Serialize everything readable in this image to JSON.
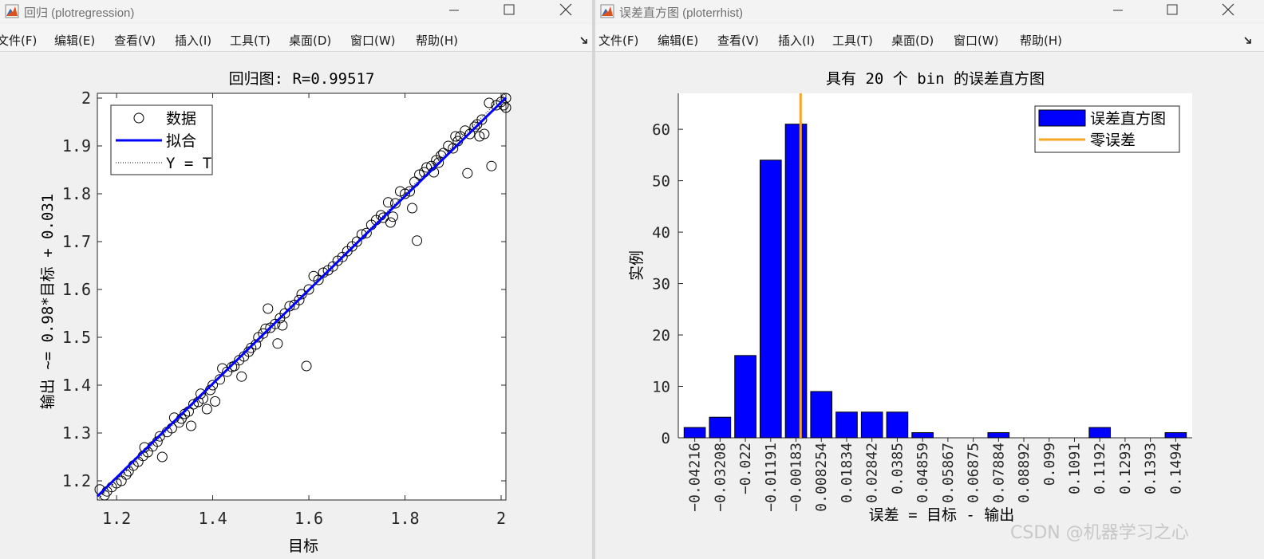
{
  "left_window": {
    "title": "回归 (plotregression)",
    "menu": [
      "文件(F)",
      "编辑(E)",
      "查看(V)",
      "插入(I)",
      "工具(T)",
      "桌面(D)",
      "窗口(W)",
      "帮助(H)"
    ],
    "icons": [
      "matlab-icon",
      "minimize-icon",
      "maximize-icon",
      "close-icon",
      "dock-arrow-icon"
    ]
  },
  "right_window": {
    "title": "误差直方图 (ploterrhist)",
    "menu": [
      "文件(F)",
      "编辑(E)",
      "查看(V)",
      "插入(I)",
      "工具(T)",
      "桌面(D)",
      "窗口(W)",
      "帮助(H)"
    ],
    "icons": [
      "matlab-icon",
      "minimize-icon",
      "maximize-icon",
      "close-icon",
      "dock-arrow-icon"
    ]
  },
  "watermark": "CSDN @机器学习之心",
  "chart_data": [
    {
      "type": "scatter",
      "title": "回归图: R=0.99517",
      "xlabel": "目标",
      "ylabel": "输出 ~= 0.98*目标 + 0.031",
      "xlim": [
        1.16,
        2.01
      ],
      "ylim": [
        1.16,
        2.01
      ],
      "xticks": [
        1.2,
        1.4,
        1.6,
        1.8,
        2
      ],
      "yticks": [
        1.2,
        1.3,
        1.4,
        1.5,
        1.6,
        1.7,
        1.8,
        1.9,
        2
      ],
      "tick_labels_x": [
        "1.2",
        "1.4",
        "1.6",
        "1.8",
        "2"
      ],
      "tick_labels_y": [
        "1.2",
        "1.3",
        "1.4",
        "1.5",
        "1.6",
        "1.7",
        "1.8",
        "1.9",
        "2"
      ],
      "legend": [
        "数据",
        "拟合",
        "Y = T"
      ],
      "legend_position": "top-left",
      "fit": {
        "slope": 0.98,
        "intercept": 0.031
      },
      "colors": {
        "fit": "#0000ff",
        "markers": "#000000",
        "ideal": "#000000"
      },
      "points": [
        [
          1.165,
          1.182
        ],
        [
          1.175,
          1.17
        ],
        [
          1.18,
          1.178
        ],
        [
          1.19,
          1.187
        ],
        [
          1.2,
          1.195
        ],
        [
          1.21,
          1.2
        ],
        [
          1.22,
          1.213
        ],
        [
          1.225,
          1.22
        ],
        [
          1.235,
          1.232
        ],
        [
          1.245,
          1.24
        ],
        [
          1.255,
          1.252
        ],
        [
          1.258,
          1.27
        ],
        [
          1.265,
          1.26
        ],
        [
          1.275,
          1.272
        ],
        [
          1.285,
          1.282
        ],
        [
          1.29,
          1.293
        ],
        [
          1.295,
          1.25
        ],
        [
          1.305,
          1.302
        ],
        [
          1.315,
          1.31
        ],
        [
          1.32,
          1.332
        ],
        [
          1.33,
          1.322
        ],
        [
          1.335,
          1.33
        ],
        [
          1.342,
          1.34
        ],
        [
          1.35,
          1.345
        ],
        [
          1.355,
          1.315
        ],
        [
          1.36,
          1.36
        ],
        [
          1.37,
          1.365
        ],
        [
          1.375,
          1.382
        ],
        [
          1.38,
          1.372
        ],
        [
          1.388,
          1.35
        ],
        [
          1.395,
          1.39
        ],
        [
          1.4,
          1.4
        ],
        [
          1.405,
          1.366
        ],
        [
          1.415,
          1.412
        ],
        [
          1.42,
          1.435
        ],
        [
          1.43,
          1.428
        ],
        [
          1.44,
          1.438
        ],
        [
          1.445,
          1.44
        ],
        [
          1.455,
          1.452
        ],
        [
          1.46,
          1.418
        ],
        [
          1.465,
          1.46
        ],
        [
          1.475,
          1.47
        ],
        [
          1.48,
          1.478
        ],
        [
          1.49,
          1.485
        ],
        [
          1.495,
          1.5
        ],
        [
          1.505,
          1.508
        ],
        [
          1.51,
          1.518
        ],
        [
          1.515,
          1.56
        ],
        [
          1.52,
          1.52
        ],
        [
          1.53,
          1.528
        ],
        [
          1.535,
          1.487
        ],
        [
          1.54,
          1.54
        ],
        [
          1.545,
          1.525
        ],
        [
          1.55,
          1.55
        ],
        [
          1.56,
          1.565
        ],
        [
          1.57,
          1.568
        ],
        [
          1.58,
          1.578
        ],
        [
          1.585,
          1.59
        ],
        [
          1.595,
          1.44
        ],
        [
          1.6,
          1.6
        ],
        [
          1.61,
          1.628
        ],
        [
          1.62,
          1.62
        ],
        [
          1.63,
          1.635
        ],
        [
          1.64,
          1.64
        ],
        [
          1.65,
          1.648
        ],
        [
          1.66,
          1.66
        ],
        [
          1.67,
          1.668
        ],
        [
          1.68,
          1.68
        ],
        [
          1.69,
          1.69
        ],
        [
          1.7,
          1.7
        ],
        [
          1.71,
          1.715
        ],
        [
          1.72,
          1.718
        ],
        [
          1.73,
          1.735
        ],
        [
          1.74,
          1.745
        ],
        [
          1.75,
          1.755
        ],
        [
          1.755,
          1.75
        ],
        [
          1.765,
          1.782
        ],
        [
          1.77,
          1.74
        ],
        [
          1.775,
          1.752
        ],
        [
          1.78,
          1.78
        ],
        [
          1.79,
          1.805
        ],
        [
          1.8,
          1.8
        ],
        [
          1.81,
          1.805
        ],
        [
          1.815,
          1.77
        ],
        [
          1.82,
          1.825
        ],
        [
          1.825,
          1.702
        ],
        [
          1.83,
          1.84
        ],
        [
          1.84,
          1.845
        ],
        [
          1.845,
          1.855
        ],
        [
          1.855,
          1.858
        ],
        [
          1.86,
          1.845
        ],
        [
          1.865,
          1.87
        ],
        [
          1.87,
          1.865
        ],
        [
          1.875,
          1.88
        ],
        [
          1.88,
          1.885
        ],
        [
          1.89,
          1.9
        ],
        [
          1.9,
          1.895
        ],
        [
          1.905,
          1.92
        ],
        [
          1.91,
          1.91
        ],
        [
          1.915,
          1.92
        ],
        [
          1.925,
          1.932
        ],
        [
          1.93,
          1.843
        ],
        [
          1.935,
          1.925
        ],
        [
          1.945,
          1.94
        ],
        [
          1.95,
          1.945
        ],
        [
          1.955,
          1.92
        ],
        [
          1.96,
          1.955
        ],
        [
          1.965,
          1.925
        ],
        [
          1.975,
          1.99
        ],
        [
          1.98,
          1.858
        ],
        [
          1.99,
          1.985
        ],
        [
          2.0,
          1.992
        ],
        [
          2.005,
          1.985
        ],
        [
          2.01,
          2.0
        ],
        [
          2.01,
          1.98
        ]
      ]
    },
    {
      "type": "bar",
      "title": "具有 20 个 bin 的误差直方图",
      "xlabel": "误差 = 目标 - 输出",
      "ylabel": "实例",
      "ylim": [
        0,
        67
      ],
      "yticks": [
        0,
        10,
        20,
        30,
        40,
        50,
        60
      ],
      "categories": [
        "-0.04216",
        "-0.03208",
        "-0.022",
        "-0.01191",
        "-0.00183",
        "0.008254",
        "0.01834",
        "0.02842",
        "0.0385",
        "0.04859",
        "0.05867",
        "0.06875",
        "0.07884",
        "0.08892",
        "0.099",
        "0.1091",
        "0.1192",
        "0.1293",
        "0.1393",
        "0.1494"
      ],
      "values": [
        2,
        4,
        16,
        54,
        61,
        9,
        5,
        5,
        5,
        1,
        0,
        0,
        1,
        0,
        0,
        0,
        2,
        0,
        0,
        1
      ],
      "zero_error_at": 0,
      "legend": [
        "误差直方图",
        "零误差"
      ],
      "legend_position": "top-right",
      "colors": {
        "bars": "#0000ff",
        "zero_line": "#f5a623"
      }
    }
  ]
}
